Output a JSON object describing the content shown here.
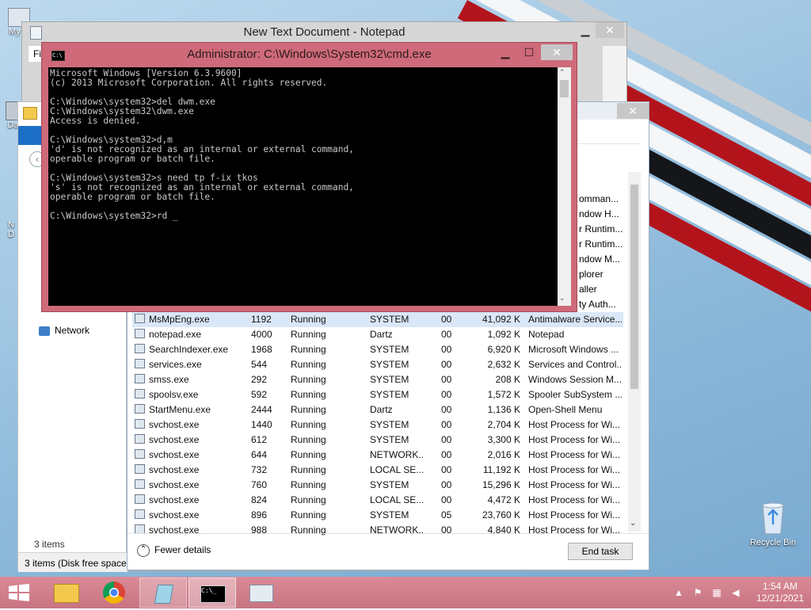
{
  "desktop": {
    "icons": [
      {
        "label": "My C"
      },
      {
        "label": "Dat"
      },
      {
        "label": "N\nD"
      },
      {
        "label": "Recycle Bin"
      }
    ]
  },
  "notepad": {
    "title": "New Text Document - Notepad",
    "menu_first": "Fi"
  },
  "explorer": {
    "nav_item": "Network",
    "items_count": "3 items",
    "status": "3 items (Disk free space:"
  },
  "cmd": {
    "title": "Administrator: C:\\Windows\\System32\\cmd.exe",
    "lines": "Microsoft Windows [Version 6.3.9600]\n(c) 2013 Microsoft Corporation. All rights reserved.\n\nC:\\Windows\\system32>del dwm.exe\nC:\\Windows\\system32\\dwm.exe\nAccess is denied.\n\nC:\\Windows\\system32>d,m\n'd' is not recognized as an internal or external command,\noperable program or batch file.\n\nC:\\Windows\\system32>s need tp f-ix tkos\n's' is not recognized as an internal or external command,\noperable program or batch file.\n\nC:\\Windows\\system32>rd _"
  },
  "taskmgr": {
    "hidden_desc": [
      "omman...",
      "ndow H...",
      "r Runtim...",
      "r Runtim...",
      "ndow M...",
      "plorer",
      "aller",
      "ty Auth..."
    ],
    "rows": [
      {
        "name": "MsMpEng.exe",
        "pid": "1192",
        "status": "Running",
        "user": "SYSTEM",
        "cpu": "00",
        "mem": "41,092 K",
        "desc": "Antimalware Service..."
      },
      {
        "name": "notepad.exe",
        "pid": "4000",
        "status": "Running",
        "user": "Dartz",
        "cpu": "00",
        "mem": "1,092 K",
        "desc": "Notepad"
      },
      {
        "name": "SearchIndexer.exe",
        "pid": "1968",
        "status": "Running",
        "user": "SYSTEM",
        "cpu": "00",
        "mem": "6,920 K",
        "desc": "Microsoft Windows ..."
      },
      {
        "name": "services.exe",
        "pid": "544",
        "status": "Running",
        "user": "SYSTEM",
        "cpu": "00",
        "mem": "2,632 K",
        "desc": "Services and Control..."
      },
      {
        "name": "smss.exe",
        "pid": "292",
        "status": "Running",
        "user": "SYSTEM",
        "cpu": "00",
        "mem": "208 K",
        "desc": "Windows Session M..."
      },
      {
        "name": "spoolsv.exe",
        "pid": "592",
        "status": "Running",
        "user": "SYSTEM",
        "cpu": "00",
        "mem": "1,572 K",
        "desc": "Spooler SubSystem ..."
      },
      {
        "name": "StartMenu.exe",
        "pid": "2444",
        "status": "Running",
        "user": "Dartz",
        "cpu": "00",
        "mem": "1,136 K",
        "desc": "Open-Shell Menu"
      },
      {
        "name": "svchost.exe",
        "pid": "1440",
        "status": "Running",
        "user": "SYSTEM",
        "cpu": "00",
        "mem": "2,704 K",
        "desc": "Host Process for Wi..."
      },
      {
        "name": "svchost.exe",
        "pid": "612",
        "status": "Running",
        "user": "SYSTEM",
        "cpu": "00",
        "mem": "3,300 K",
        "desc": "Host Process for Wi..."
      },
      {
        "name": "svchost.exe",
        "pid": "644",
        "status": "Running",
        "user": "NETWORK...",
        "cpu": "00",
        "mem": "2,016 K",
        "desc": "Host Process for Wi..."
      },
      {
        "name": "svchost.exe",
        "pid": "732",
        "status": "Running",
        "user": "LOCAL SE...",
        "cpu": "00",
        "mem": "11,192 K",
        "desc": "Host Process for Wi..."
      },
      {
        "name": "svchost.exe",
        "pid": "760",
        "status": "Running",
        "user": "SYSTEM",
        "cpu": "00",
        "mem": "15,296 K",
        "desc": "Host Process for Wi..."
      },
      {
        "name": "svchost.exe",
        "pid": "824",
        "status": "Running",
        "user": "LOCAL SE...",
        "cpu": "00",
        "mem": "4,472 K",
        "desc": "Host Process for Wi..."
      },
      {
        "name": "svchost.exe",
        "pid": "896",
        "status": "Running",
        "user": "SYSTEM",
        "cpu": "05",
        "mem": "23,760 K",
        "desc": "Host Process for Wi..."
      },
      {
        "name": "svchost.exe",
        "pid": "988",
        "status": "Running",
        "user": "NETWORK...",
        "cpu": "00",
        "mem": "4,840 K",
        "desc": "Host Process for Wi..."
      }
    ],
    "fewer_details": "Fewer details",
    "end_task": "End task"
  },
  "taskbar": {
    "time": "1:54 AM",
    "date": "12/21/2021"
  },
  "colors": {
    "cmd_frame": "#cf6a7a",
    "taskbar": "#c87482",
    "console_bg": "#000000",
    "console_fg": "#c8c8c8"
  }
}
